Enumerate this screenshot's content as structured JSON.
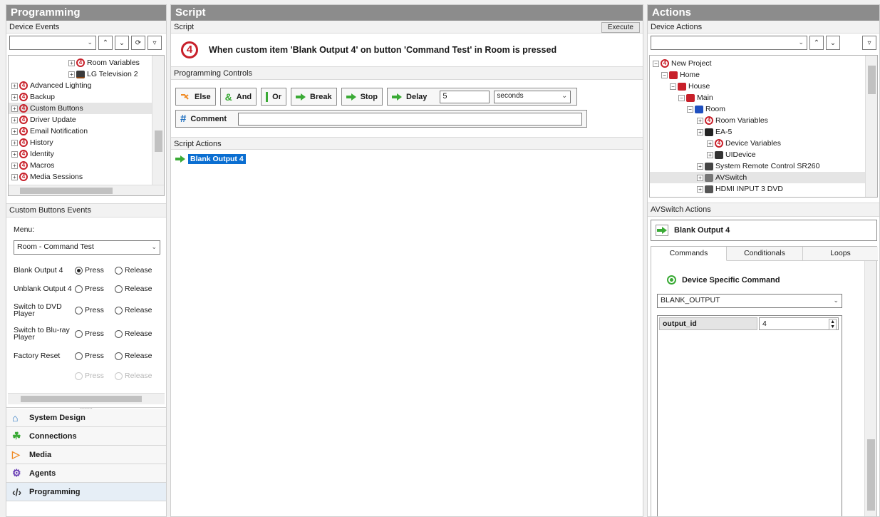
{
  "left": {
    "title": "Programming",
    "device_events_header": "Device Events",
    "tree_items": [
      {
        "label": "Room Variables",
        "indent": 84,
        "icon": "c4-icon"
      },
      {
        "label": "LG Television 2",
        "indent": 84,
        "icon": "tv-icon"
      },
      {
        "label": "Advanced Lighting",
        "indent": 4,
        "icon": "c4-icon"
      },
      {
        "label": "Backup",
        "indent": 4,
        "icon": "c4-icon"
      },
      {
        "label": "Custom Buttons",
        "indent": 4,
        "icon": "c4-icon"
      },
      {
        "label": "Driver Update",
        "indent": 4,
        "icon": "c4-icon"
      },
      {
        "label": "Email Notification",
        "indent": 4,
        "icon": "c4-icon"
      },
      {
        "label": "History",
        "indent": 4,
        "icon": "c4-icon"
      },
      {
        "label": "Identity",
        "indent": 4,
        "icon": "c4-icon"
      },
      {
        "label": "Macros",
        "indent": 4,
        "icon": "c4-icon"
      },
      {
        "label": "Media Sessions",
        "indent": 4,
        "icon": "c4-icon"
      }
    ],
    "custom_events_header": "Custom Buttons Events",
    "menu_label": "Menu:",
    "menu_value": "Room - Command Test",
    "events": [
      {
        "label": "Blank Output 4",
        "press": "Press",
        "release": "Release",
        "selected": "press"
      },
      {
        "label": "Unblank Output 4",
        "press": "Press",
        "release": "Release",
        "selected": ""
      },
      {
        "label": "Switch to DVD Player",
        "press": "Press",
        "release": "Release",
        "selected": ""
      },
      {
        "label": "Switch to Blu-ray Player",
        "press": "Press",
        "release": "Release",
        "selected": ""
      },
      {
        "label": "Factory Reset",
        "press": "Press",
        "release": "Release",
        "selected": ""
      },
      {
        "label": "",
        "press": "Press",
        "release": "Release",
        "selected": "",
        "disabled": true
      }
    ],
    "nav": [
      {
        "label": "System Design",
        "icon": "system-design-icon"
      },
      {
        "label": "Connections",
        "icon": "connections-icon"
      },
      {
        "label": "Media",
        "icon": "media-icon"
      },
      {
        "label": "Agents",
        "icon": "agents-icon"
      },
      {
        "label": "Programming",
        "icon": "code-icon"
      }
    ]
  },
  "middle": {
    "title": "Script",
    "script_header": "Script",
    "execute_label": "Execute",
    "script_text": "When custom item 'Blank Output 4' on button 'Command Test' in Room is pressed",
    "controls_header": "Programming Controls",
    "controls": {
      "else": "Else",
      "and": "And",
      "or": "Or",
      "break": "Break",
      "stop": "Stop",
      "delay": "Delay",
      "delay_value": "5",
      "delay_unit": "seconds",
      "comment": "Comment"
    },
    "actions_header": "Script Actions",
    "action_item": "Blank Output 4"
  },
  "right": {
    "title": "Actions",
    "device_actions_header": "Device Actions",
    "tree_items": [
      {
        "label": "New Project",
        "indent": 4
      },
      {
        "label": "Home",
        "indent": 16
      },
      {
        "label": "House",
        "indent": 28
      },
      {
        "label": "Main",
        "indent": 40
      },
      {
        "label": "Room",
        "indent": 52
      },
      {
        "label": "Room Variables",
        "indent": 66
      },
      {
        "label": "EA-5",
        "indent": 66
      },
      {
        "label": "Device Variables",
        "indent": 80
      },
      {
        "label": "UIDevice",
        "indent": 80
      },
      {
        "label": "System Remote Control SR260",
        "indent": 66
      },
      {
        "label": "AVSwitch",
        "indent": 66
      },
      {
        "label": "HDMI INPUT 3 DVD",
        "indent": 66
      }
    ],
    "avswitch_header": "AVSwitch Actions",
    "selected_action": "Blank Output 4",
    "tabs": [
      "Commands",
      "Conditionals",
      "Loops"
    ],
    "device_specific_label": "Device Specific Command",
    "command_value": "BLANK_OUTPUT",
    "param_name": "output_id",
    "param_value": "4"
  },
  "colors": {
    "accent": "#c8202a",
    "title_bar": "#8c8c8c",
    "selection": "#0a6ed1",
    "green": "#3aaa35"
  }
}
